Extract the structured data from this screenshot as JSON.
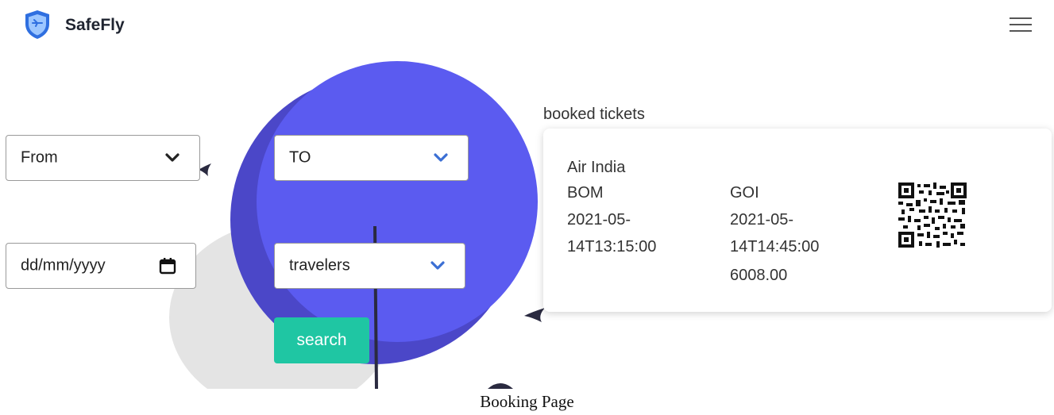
{
  "app": {
    "name": "SafeFly",
    "logo_icon": "shield-plane-icon",
    "menu_icon": "hamburger-icon"
  },
  "colors": {
    "circle": "#5b5bf0",
    "circle_shadow": "#4b47c8",
    "accent": "#1fc6a3",
    "chevron": "#3b6fd4"
  },
  "form": {
    "from": {
      "value": "From"
    },
    "to": {
      "value": "TO"
    },
    "date": {
      "placeholder": "dd/mm/yyyy",
      "display": "dd/mm/yyyy"
    },
    "travelers": {
      "value": "travelers"
    },
    "search_label": "search"
  },
  "booked": {
    "heading": "booked tickets",
    "tickets": [
      {
        "airline": "Air India",
        "from_code": "BOM",
        "depart_line1": "2021-05-",
        "depart_line2": "14T13:15:00",
        "to_code": "GOI",
        "arrive_line1": "2021-05-",
        "arrive_line2": "14T14:45:00",
        "price": "6008.00"
      }
    ]
  },
  "caption": "Booking Page"
}
